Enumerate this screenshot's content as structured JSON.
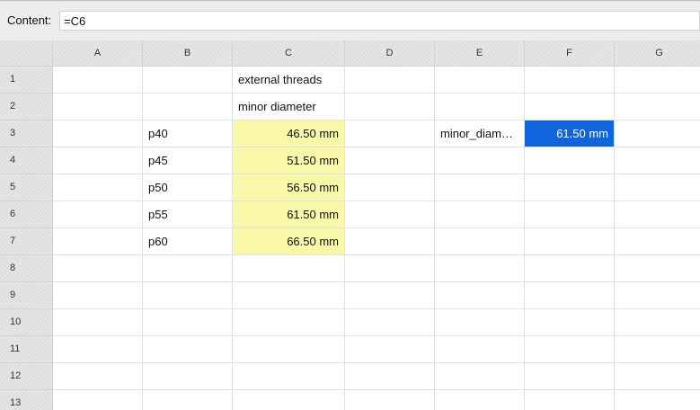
{
  "content_bar": {
    "label": "Content:",
    "value": "=C6"
  },
  "columns": [
    "A",
    "B",
    "C",
    "D",
    "E",
    "F",
    "G"
  ],
  "rows": [
    "1",
    "2",
    "3",
    "4",
    "5",
    "6",
    "7",
    "8",
    "9",
    "10",
    "11",
    "12",
    "13"
  ],
  "cells": {
    "C1": "external threads",
    "C2": "minor diameter",
    "B3": "p40",
    "C3": "46.50 mm",
    "E3": "minor_diameter",
    "F3": "61.50 mm",
    "B4": "p45",
    "C4": "51.50 mm",
    "B5": "p50",
    "C5": "56.50 mm",
    "B6": "p55",
    "C6": "61.50 mm",
    "B7": "p60",
    "C7": "66.50 mm"
  },
  "colors": {
    "highlight_yellow": "#f8f8a8",
    "selection_blue": "#1065dc"
  }
}
